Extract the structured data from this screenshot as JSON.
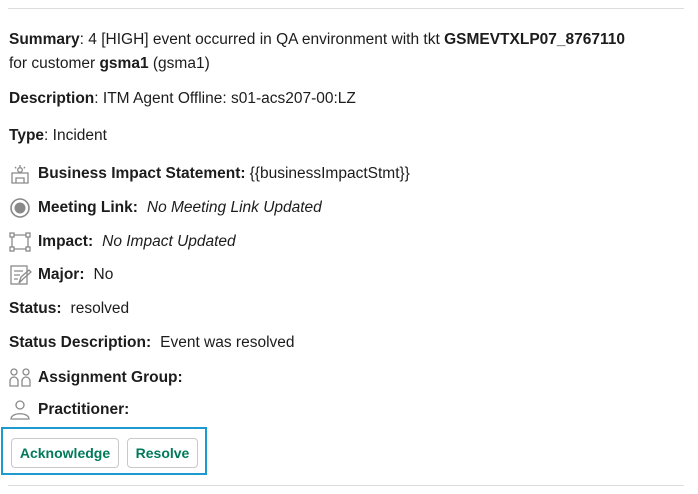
{
  "summary": {
    "label": "Summary",
    "text1": " 4 [HIGH] event occurred in QA environment with  tkt ",
    "ticket": "GSMEVTXLP07_8767110",
    "text2": "for customer ",
    "customer": "gsma1",
    "text3": " (gsma1)"
  },
  "description": {
    "label": "Description",
    "value": " ITM Agent Offline: s01-acs207-00:LZ"
  },
  "type": {
    "label": "Type",
    "value": " Incident"
  },
  "business_impact": {
    "label": "Business Impact Statement:",
    "value": "{{businessImpactStmt}}",
    "icon": "business-impact-icon"
  },
  "meeting_link": {
    "label": "Meeting Link:",
    "value": "No Meeting Link Updated",
    "icon": "meeting-link-icon"
  },
  "impact": {
    "label": "Impact:",
    "value": "No Impact Updated",
    "icon": "impact-icon"
  },
  "major": {
    "label": "Major:",
    "value": "No",
    "icon": "major-icon"
  },
  "status": {
    "label": "Status:",
    "value": "resolved"
  },
  "status_description": {
    "label": "Status Description:",
    "value": "Event was resolved"
  },
  "assignment_group": {
    "label": "Assignment Group:",
    "icon": "group-icon"
  },
  "practitioner": {
    "label": "Practitioner:",
    "icon": "person-icon"
  },
  "actions": {
    "acknowledge_label": "Acknowledge",
    "resolve_label": "Resolve",
    "accent_color": "#007a5a",
    "focus_color": "#1d9bd1"
  }
}
